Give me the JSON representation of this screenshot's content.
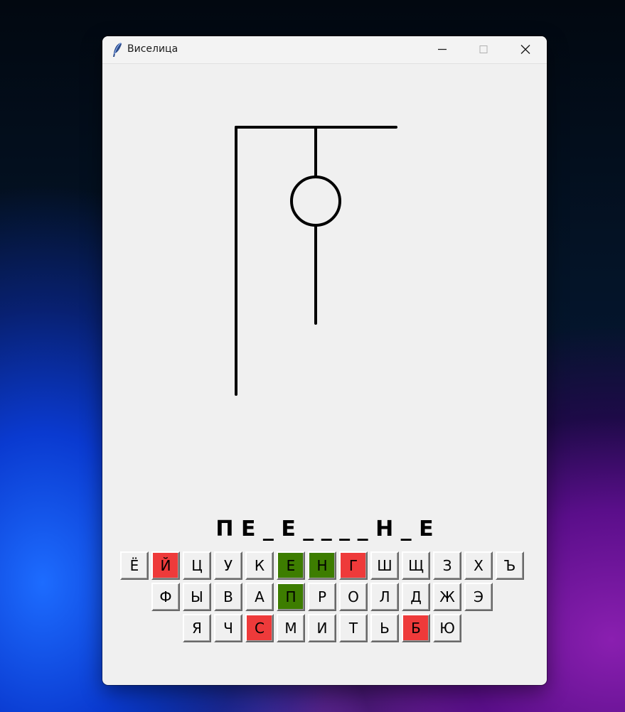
{
  "window": {
    "title": "Виселица"
  },
  "game": {
    "word_display": "П Е _ Е _ _ _ _ Н _ Е",
    "colors": {
      "correct": "#3d7d00",
      "wrong": "#ee3a3a",
      "default": "#f0f0f0"
    }
  },
  "keyboard": {
    "rows": [
      [
        {
          "label": "Ё",
          "state": "default"
        },
        {
          "label": "Й",
          "state": "wrong"
        },
        {
          "label": "Ц",
          "state": "default"
        },
        {
          "label": "У",
          "state": "default"
        },
        {
          "label": "К",
          "state": "default"
        },
        {
          "label": "Е",
          "state": "correct"
        },
        {
          "label": "Н",
          "state": "correct"
        },
        {
          "label": "Г",
          "state": "wrong"
        },
        {
          "label": "Ш",
          "state": "default"
        },
        {
          "label": "Щ",
          "state": "default"
        },
        {
          "label": "З",
          "state": "default"
        },
        {
          "label": "Х",
          "state": "default"
        },
        {
          "label": "Ъ",
          "state": "default"
        }
      ],
      [
        {
          "label": "Ф",
          "state": "default"
        },
        {
          "label": "Ы",
          "state": "default"
        },
        {
          "label": "В",
          "state": "default"
        },
        {
          "label": "А",
          "state": "default"
        },
        {
          "label": "П",
          "state": "correct"
        },
        {
          "label": "Р",
          "state": "default"
        },
        {
          "label": "О",
          "state": "default"
        },
        {
          "label": "Л",
          "state": "default"
        },
        {
          "label": "Д",
          "state": "default"
        },
        {
          "label": "Ж",
          "state": "default"
        },
        {
          "label": "Э",
          "state": "default"
        }
      ],
      [
        {
          "label": "Я",
          "state": "default"
        },
        {
          "label": "Ч",
          "state": "default"
        },
        {
          "label": "С",
          "state": "wrong"
        },
        {
          "label": "М",
          "state": "default"
        },
        {
          "label": "И",
          "state": "default"
        },
        {
          "label": "Т",
          "state": "default"
        },
        {
          "label": "Ь",
          "state": "default"
        },
        {
          "label": "Б",
          "state": "wrong"
        },
        {
          "label": "Ю",
          "state": "default"
        }
      ]
    ]
  }
}
